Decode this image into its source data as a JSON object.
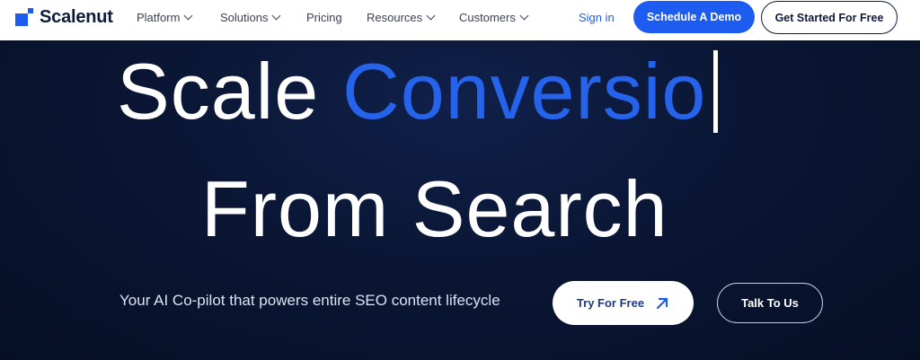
{
  "brand": {
    "name": "Scalenut",
    "accent_color": "#1d5cf0"
  },
  "nav": {
    "items": [
      {
        "label": "Platform",
        "has_dropdown": true
      },
      {
        "label": "Solutions",
        "has_dropdown": true
      },
      {
        "label": "Pricing",
        "has_dropdown": false
      },
      {
        "label": "Resources",
        "has_dropdown": true
      },
      {
        "label": "Customers",
        "has_dropdown": true
      }
    ],
    "signin": "Sign in",
    "demo_button": "Schedule A Demo",
    "start_button": "Get Started For Free"
  },
  "hero": {
    "headline_word": "Scale",
    "headline_accent": "Conversio",
    "headline_line2": "From Search",
    "tagline": "Your AI Co-pilot that powers entire SEO content lifecycle",
    "try_button": "Try For Free",
    "talk_button": "Talk To Us",
    "background_color": "#07112a",
    "accent_color": "#2563eb"
  }
}
